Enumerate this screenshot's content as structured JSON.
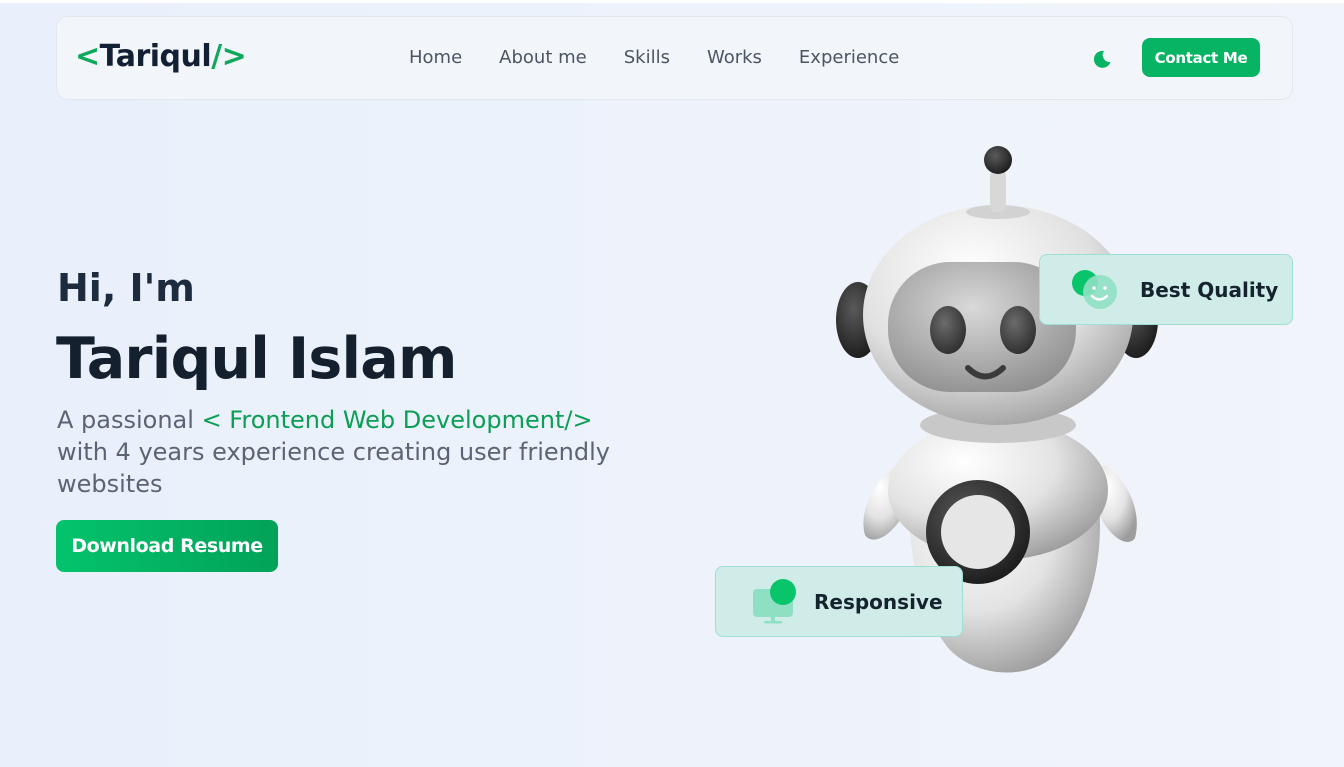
{
  "nav": {
    "logo_open": "<",
    "logo_name": "Tariqul",
    "logo_close": "/>",
    "links": [
      "Home",
      "About me",
      "Skills",
      "Works",
      "Experience"
    ],
    "theme_icon": "moon-icon",
    "contact_label": "Contact Me"
  },
  "hero": {
    "greeting": "Hi, I'm",
    "name": "Tariqul Islam",
    "desc_prefix": "A passional ",
    "role": "< Frontend Web Development/>",
    "desc_suffix": " with 4 years experience creating user friendly websites",
    "download_label": "Download Resume"
  },
  "badges": {
    "quality": {
      "label": "Best Quality",
      "icon": "smile-icon"
    },
    "responsive": {
      "label": "Responsive",
      "icon": "monitor-icon"
    }
  },
  "colors": {
    "accent": "#06b463",
    "accent_text": "#0c9e55",
    "badge_bg": "#cfece8",
    "heading": "#14202e"
  }
}
